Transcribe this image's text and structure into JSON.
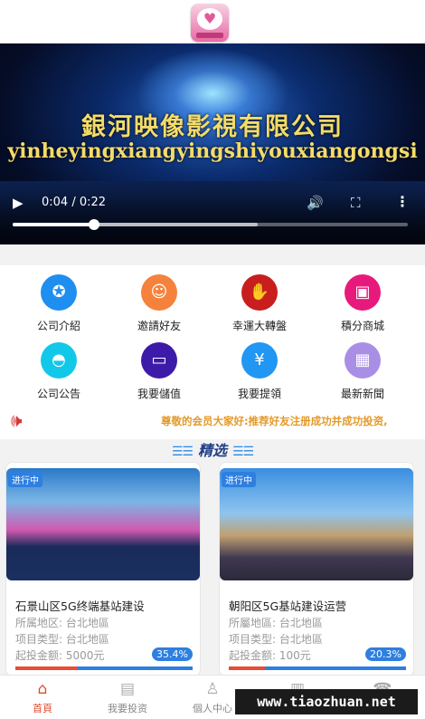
{
  "header": {
    "logo_icon": "heart-app-logo"
  },
  "video": {
    "title_cn": "銀河映像影視有限公司",
    "title_pinyin": "yinheyingxiangyingshiyouxiangongsi",
    "time": "0:04 / 0:22",
    "progress": 0.205,
    "buffered": 0.62
  },
  "menu": [
    {
      "label": "公司介紹",
      "icon": "medal-icon",
      "color": "#1e8ef0"
    },
    {
      "label": "邀請好友",
      "icon": "invite-icon",
      "color": "#f5823c"
    },
    {
      "label": "幸運大轉盤",
      "icon": "handshake-icon",
      "color": "#c81e1e"
    },
    {
      "label": "積分商城",
      "icon": "points-mall-icon",
      "color": "#e8197c"
    },
    {
      "label": "公司公告",
      "icon": "android-icon",
      "color": "#12c8e8"
    },
    {
      "label": "我要儲值",
      "icon": "wallet-icon",
      "color": "#3d1aa8"
    },
    {
      "label": "我要提領",
      "icon": "yen-coin-icon",
      "color": "#2196f3"
    },
    {
      "label": "最新新聞",
      "icon": "grid-icon",
      "color": "#a98ee6"
    }
  ],
  "notice": {
    "text": "尊敬的会员大家好:推荐好友注册成功并成功投资,"
  },
  "section": {
    "title": "精选"
  },
  "projects": [
    {
      "tag": "进行中",
      "name": "石景山区5G终端基站建设",
      "region_label": "所属地区:",
      "region": "台北地區",
      "type_label": "项目类型:",
      "type": "台北地區",
      "amount_label": "起投金额:",
      "amount": "5000元",
      "percent_label": "35.4%",
      "percent": 0.354
    },
    {
      "tag": "进行中",
      "name": "朝阳区5G基站建设运营",
      "region_label": "所屬地區:",
      "region": "台北地區",
      "type_label": "项目类型:",
      "type": "台北地區",
      "amount_label": "起投金额:",
      "amount": "100元",
      "percent_label": "20.3%",
      "percent": 0.203
    }
  ],
  "tabs": [
    {
      "label": "首頁",
      "icon": "home-icon",
      "active": true
    },
    {
      "label": "我要投资",
      "icon": "bar-chart-icon",
      "active": false
    },
    {
      "label": "個人中心",
      "icon": "user-icon",
      "active": false
    },
    {
      "label": "",
      "icon": "map-icon",
      "active": false
    },
    {
      "label": "",
      "icon": "service-icon",
      "active": false
    }
  ],
  "watermark": "www.tiaozhuan.net",
  "colors": {
    "accent": "#2e7fe0",
    "active_tab": "#e04b2e",
    "notice": "#e39a2a"
  }
}
